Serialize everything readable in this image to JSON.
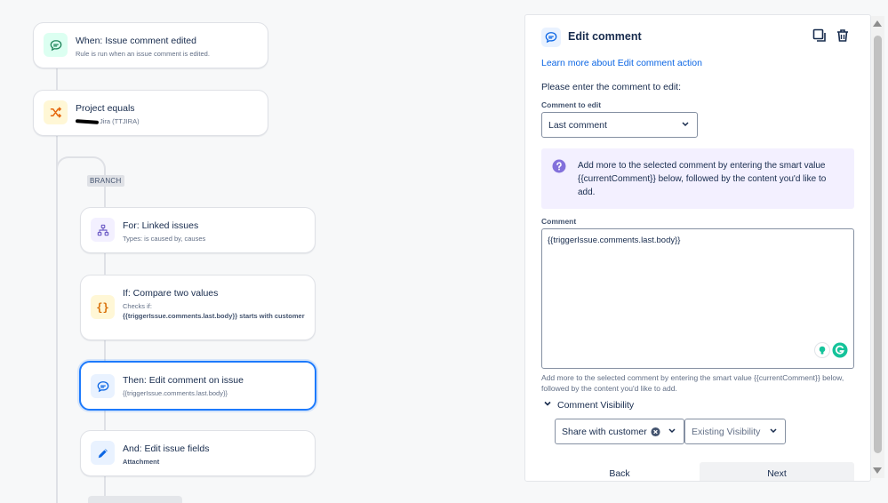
{
  "flow": {
    "trigger": {
      "title": "When: Issue comment edited",
      "subtitle": "Rule is run when an issue comment is edited."
    },
    "condition": {
      "title": "Project equals",
      "subtitle": "Jira (TTJIRA)"
    },
    "branch_label": "BRANCH",
    "for_linked": {
      "title": "For: Linked issues",
      "subtitle": "Types: is caused by, causes"
    },
    "compare": {
      "title": "If: Compare two values",
      "checks_label": "Checks if:",
      "checks_value": "{{triggerIssue.comments.last.body}} starts with customer"
    },
    "edit_comment": {
      "title": "Then: Edit comment on issue",
      "subtitle": "{{triggerIssue.comments.last.body}}"
    },
    "edit_fields": {
      "title": "And: Edit issue fields",
      "subtitle": "Attachment"
    }
  },
  "panel": {
    "title": "Edit comment",
    "learn_more": "Learn more about Edit comment action",
    "prompt": "Please enter the comment to edit:",
    "comment_to_edit_label": "Comment to edit",
    "comment_to_edit_value": "Last comment",
    "info_text": "Add more to the selected comment by entering the smart value {{currentComment}} below, followed by the content you'd like to add.",
    "comment_label": "Comment",
    "comment_value": "{{triggerIssue.comments.last.body}}",
    "helper_text": "Add more to the selected comment by entering the smart value {{currentComment}} below, followed by the content you'd like to add.",
    "visibility_label": "Comment Visibility",
    "share_value": "Share with customer",
    "existing_visibility": "Existing Visibility",
    "back_label": "Back",
    "next_label": "Next"
  },
  "colors": {
    "accent": "#1d7afc",
    "link": "#0c66e4",
    "info_bg": "#f3f0ff",
    "info_icon": "#8270db",
    "grammarly": "#15c39a"
  }
}
